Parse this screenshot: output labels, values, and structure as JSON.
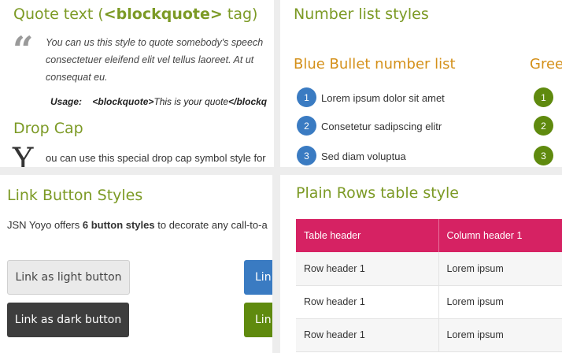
{
  "quote_section": {
    "heading_prefix": "Quote text (",
    "heading_tag": "<blockquote>",
    "heading_suffix": " tag)",
    "quote_mark": "“",
    "lines": [
      "You can us this style to quote somebody's speech",
      "consectetuer eleifend elit vel tellus laoreet. At ut",
      "consequat eu."
    ],
    "usage_label": "Usage:",
    "usage_open_tag": "<blockquote>",
    "usage_text": "This is your quote",
    "usage_close_tag": "</blockq"
  },
  "dropcap_section": {
    "heading": "Drop Cap",
    "letter": "Y",
    "text": "ou can use this special drop cap symbol style for"
  },
  "number_list": {
    "heading": "Number list styles",
    "blue_heading": "Blue Bullet number list",
    "green_heading": "Gree",
    "items": [
      {
        "num": "1",
        "text": "Lorem ipsum dolor sit amet"
      },
      {
        "num": "2",
        "text": "Consetetur sadipscing elitr"
      },
      {
        "num": "3",
        "text": "Sed diam voluptua"
      }
    ],
    "colors": {
      "blue": "#3a7bc2",
      "green": "#5f8a0e"
    }
  },
  "link_buttons": {
    "heading": "Link Button Styles",
    "intro_prefix": "JSN Yoyo offers ",
    "intro_bold": "6 button styles",
    "intro_suffix": " to decorate any call-to-a",
    "light_label": "Link as light button",
    "dark_label": "Link as dark button",
    "blue_partial": "Lin",
    "green_partial": "Lin"
  },
  "table_section": {
    "heading": "Plain Rows table style",
    "headers": [
      "Table header",
      "Column header 1"
    ],
    "rows": [
      [
        "Row header 1",
        "Lorem ipsum"
      ],
      [
        "Row header 1",
        "Lorem ipsum"
      ],
      [
        "Row header 1",
        "Lorem ipsum"
      ]
    ],
    "header_color": "#d62263"
  }
}
